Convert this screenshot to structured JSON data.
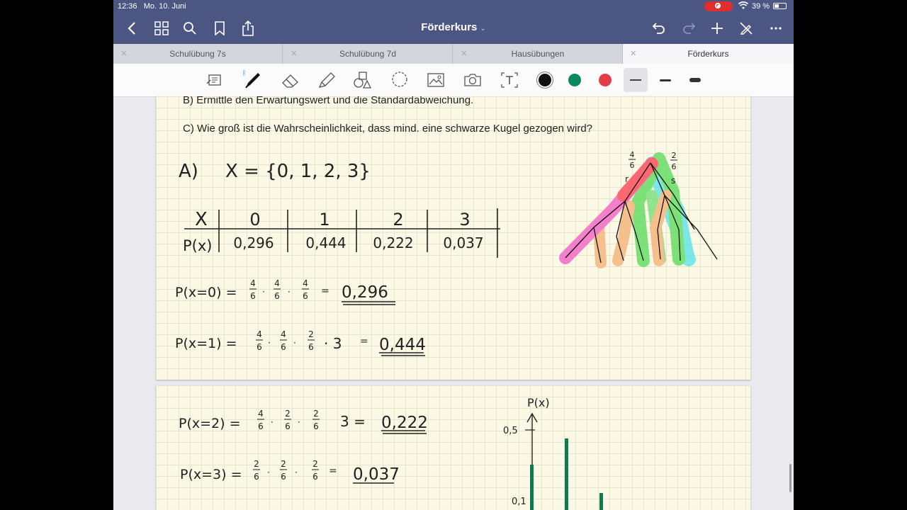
{
  "status": {
    "time": "12:36",
    "date": "Mo. 10. Juni",
    "battery": "39 %"
  },
  "nav": {
    "title": "Förderkurs"
  },
  "tabs": [
    {
      "label": "Schulübung 7s"
    },
    {
      "label": "Schulübung 7d"
    },
    {
      "label": "Hausübungen"
    },
    {
      "label": "Förderkurs"
    }
  ],
  "toolbar": {
    "pen_colors": [
      "#111111",
      "#0d8a5b",
      "#e53d47"
    ],
    "active_color": "#111111"
  },
  "page1": {
    "question_b": "B) Ermittle den Erwartungswert und die Standardabweichung.",
    "question_c": "C) Wie groß ist die Wahrscheinlichkeit, dass mind. eine schwarze Kugel gezogen wird?",
    "part_a_label": "A)",
    "set_expr": "X = {0, 1, 2, 3}",
    "table": {
      "row1_label": "X",
      "row2_label": "P(x)",
      "x": [
        "0",
        "1",
        "2",
        "3"
      ],
      "p": [
        "0,296",
        "0,444",
        "0,222",
        "0,037"
      ]
    },
    "eq0": {
      "lhs": "P(x=0) =",
      "f1n": "4",
      "f1d": "6",
      "f2n": "4",
      "f2d": "6",
      "f3n": "4",
      "f3d": "6",
      "eq": "=",
      "res": "0,296"
    },
    "eq1": {
      "lhs": "P(x=1) =",
      "f1n": "4",
      "f1d": "6",
      "f2n": "4",
      "f2d": "6",
      "f3n": "2",
      "f3d": "6",
      "mult": "· 3",
      "eq": "=",
      "res": "0,444"
    },
    "tree": {
      "left_n": "4",
      "left_d": "6",
      "left_lbl": "r",
      "right_n": "2",
      "right_d": "6",
      "right_lbl": "s"
    }
  },
  "page2": {
    "eq2": {
      "lhs": "P(x=2) =",
      "f1n": "4",
      "f1d": "6",
      "f2n": "2",
      "f2d": "6",
      "f3n": "2",
      "f3d": "6",
      "mult": "3 =",
      "res": "0,222"
    },
    "eq3": {
      "lhs": "P(x=3) =",
      "f1n": "2",
      "f1d": "6",
      "f2n": "2",
      "f2d": "6",
      "f3n": "2",
      "f3d": "6",
      "eq": "=",
      "res": "0,037"
    },
    "graph": {
      "ylabel": "P(x)",
      "tick_hi": "0,5",
      "tick_lo": "0,1",
      "bar_color": "#0f7a4f"
    }
  }
}
